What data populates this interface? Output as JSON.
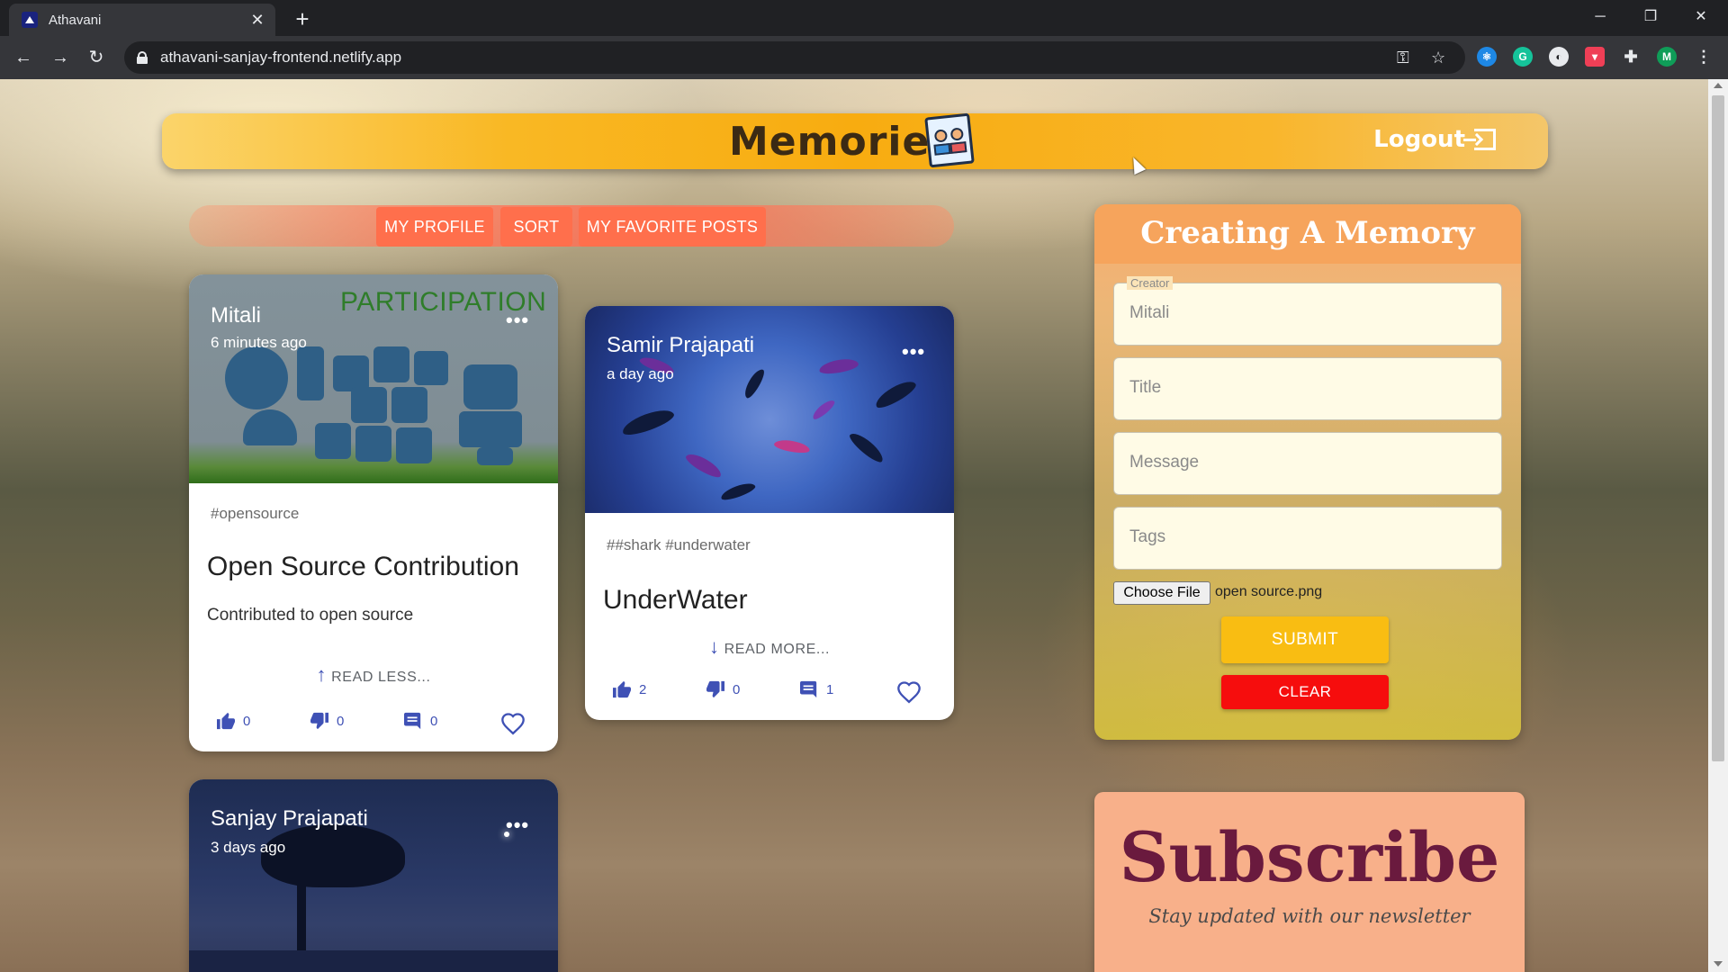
{
  "browser": {
    "tab_title": "Athavani",
    "tab_close": "✕",
    "new_tab": "+",
    "url": "athavani-sanjay-frontend.netlify.app",
    "profile_initial": "M"
  },
  "app": {
    "brand": "Memories",
    "logout_label": "Logout",
    "nav": {
      "my_profile": "MY PROFILE",
      "sort": "SORT",
      "favorites": "MY FAVORITE POSTS"
    }
  },
  "posts": [
    {
      "author": "Mitali",
      "time": "6 minutes ago",
      "image_text": "PARTICIPATION",
      "tags": "#opensource",
      "title": "Open Source Contribution",
      "message": "Contributed to open source",
      "read_toggle": "READ LESS...",
      "likes": "0",
      "dislikes": "0",
      "comments": "0"
    },
    {
      "author": "Samir Prajapati",
      "time": "a day ago",
      "tags": "##shark #underwater",
      "title": "UnderWater",
      "read_toggle": "READ MORE...",
      "likes": "2",
      "dislikes": "0",
      "comments": "1"
    },
    {
      "author": "Sanjay Prajapati",
      "time": "3 days ago"
    }
  ],
  "form": {
    "title": "Creating A Memory",
    "creator_label": "Creator",
    "creator_value": "Mitali",
    "title_placeholder": "Title",
    "message_placeholder": "Message",
    "tags_placeholder": "Tags",
    "choose_file": "Choose File",
    "file_name": "open source.png",
    "submit": "SUBMIT",
    "clear": "CLEAR"
  },
  "subscribe": {
    "title": "Subscribe",
    "tagline": "Stay updated with our newsletter"
  },
  "colors": {
    "appbar": "#f8ac10",
    "nav_button": "#ff6f4c",
    "submit": "#f9bd12",
    "clear": "#f60d0d",
    "action_icons": "#3f51b5"
  }
}
